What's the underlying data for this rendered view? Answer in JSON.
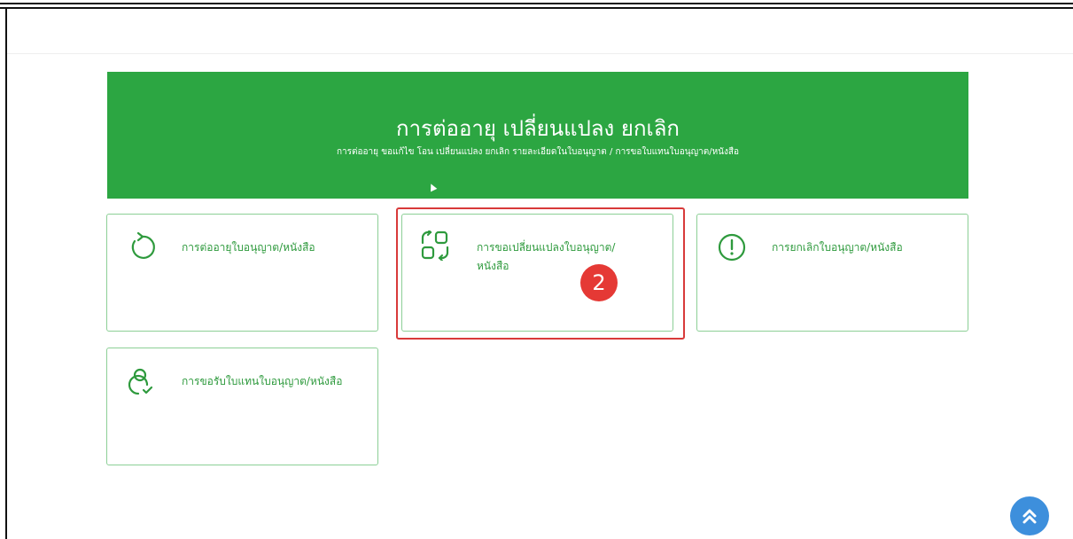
{
  "hero": {
    "title": "การต่ออายุ เปลี่ยนแปลง ยกเลิก",
    "subtitle": "การต่ออายุ ขอแก้ไข โอน เปลี่ยนแปลง ยกเลิก รายละเอียดในใบอนุญาต / การขอใบแทนใบอนุญาต/หนังสือ"
  },
  "cards": [
    {
      "label": "การต่ออายุใบอนุญาต/หนังสือ",
      "icon": "renew-icon"
    },
    {
      "label": "การขอเปลี่ยนแปลงใบอนุญาต/หนังสือ",
      "icon": "change-icon"
    },
    {
      "label": "การยกเลิกใบอนุญาต/หนังสือ",
      "icon": "cancel-alert-icon"
    },
    {
      "label": "การขอรับใบแทนใบอนุญาต/หนังสือ",
      "icon": "user-replace-icon"
    }
  ],
  "annotation": {
    "step": "2"
  },
  "colors": {
    "brand_green": "#2ca642",
    "card_border": "#8ccf96",
    "highlight": "#d83a3a",
    "badge": "#e53935",
    "scroll_button": "#3d8fdc"
  }
}
